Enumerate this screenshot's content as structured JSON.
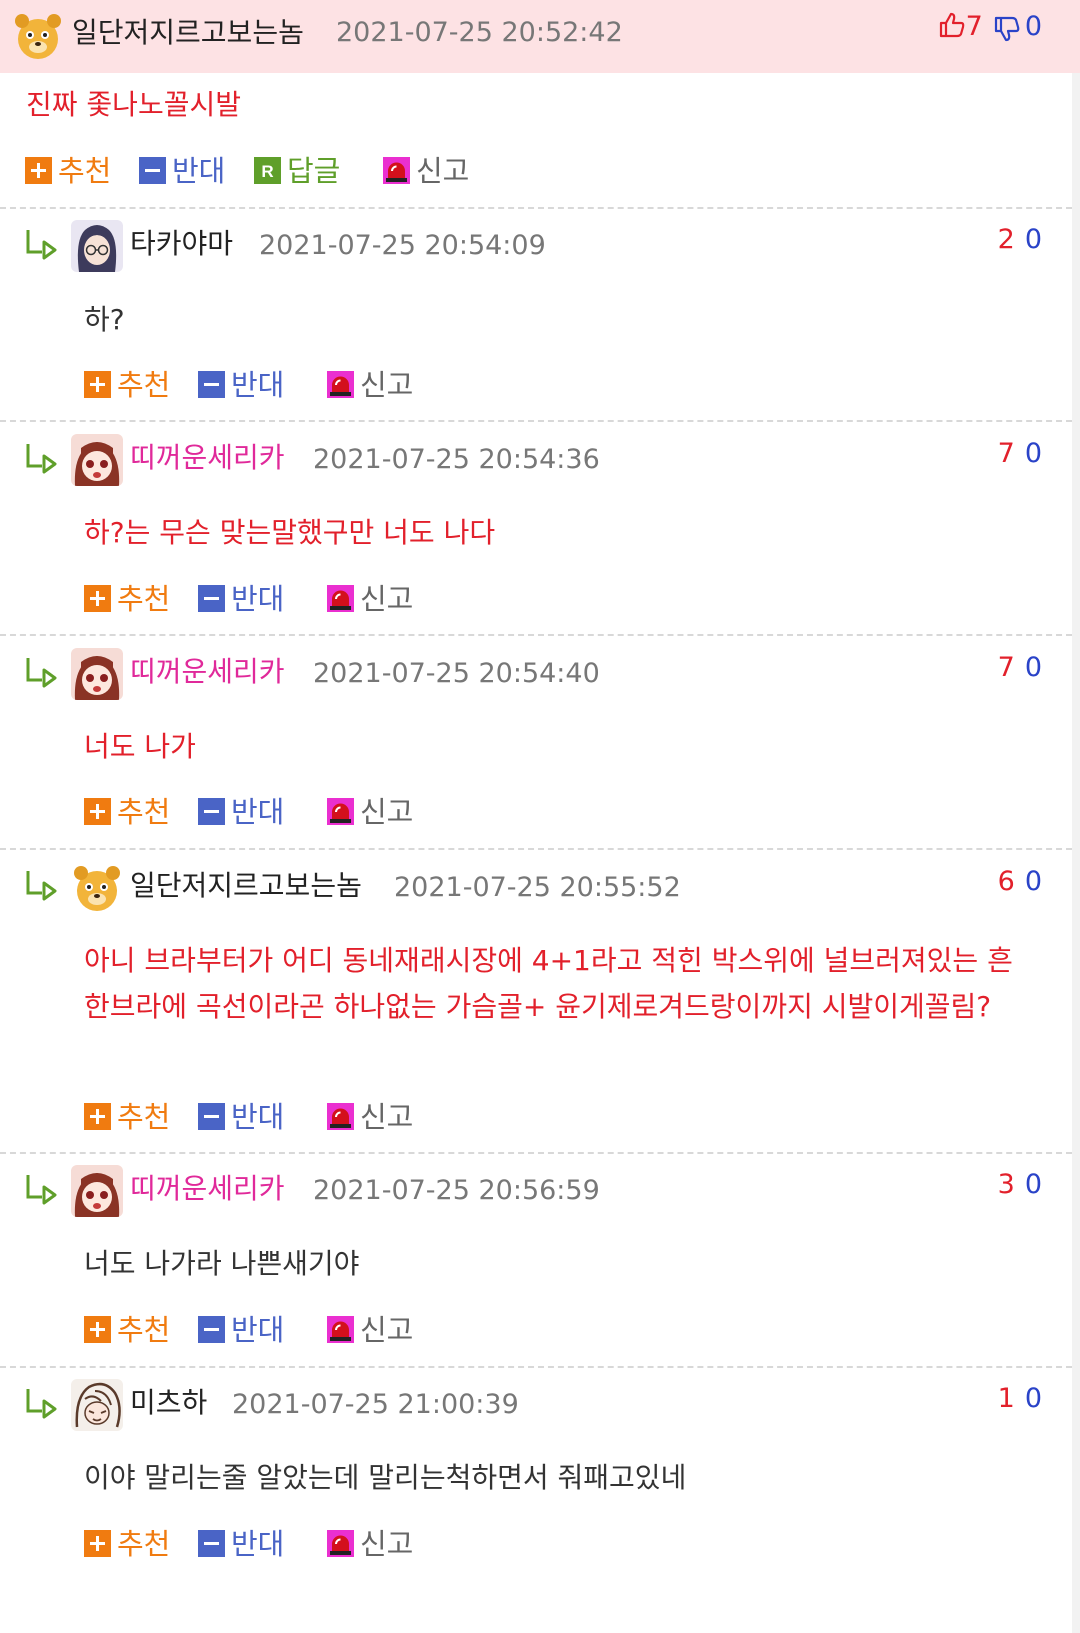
{
  "post": {
    "nick": "일단저지르고보는놈",
    "date": "2021-07-25 20:52:42",
    "up": "7",
    "down": "0",
    "text": "진짜 좇나노꼴시발"
  },
  "actions": {
    "recommend": "추천",
    "oppose": "반대",
    "reply": "답글",
    "report": "신고"
  },
  "replies": [
    {
      "nick": "타카야마",
      "date": "2021-07-25 20:54:09",
      "up": "2",
      "down": "0",
      "text": "하?"
    },
    {
      "nick": "띠꺼운세리카",
      "date": "2021-07-25 20:54:36",
      "up": "7",
      "down": "0",
      "text": "하?는 무슨 맞는말했구만 너도 나다"
    },
    {
      "nick": "띠꺼운세리카",
      "date": "2021-07-25 20:54:40",
      "up": "7",
      "down": "0",
      "text": "너도 나가"
    },
    {
      "nick": "일단저지르고보는놈",
      "date": "2021-07-25 20:55:52",
      "up": "6",
      "down": "0",
      "text": "아니 브라부터가 어디 동네재래시장에 4+1라고 적힌 박스위에 널브러져있는 흔한브라에 곡선이라곤 하나없는 가슴골+ 윤기제로겨드랑이까지 시발이게꼴림?"
    },
    {
      "nick": "띠꺼운세리카",
      "date": "2021-07-25 20:56:59",
      "up": "3",
      "down": "0",
      "text": "너도 나가라 나쁜새기야"
    },
    {
      "nick": "미츠하",
      "date": "2021-07-25 21:00:39",
      "up": "1",
      "down": "0",
      "text": "이야 말리는줄 알았는데 말리는척하면서 줘패고있네"
    }
  ],
  "colors": {
    "header_bg": "#fde2e4",
    "red_text": "#e2202b",
    "down_blue": "#2a43c8",
    "recommend_orange": "#f07b10",
    "oppose_blue": "#4a64c6",
    "reply_green": "#5f9f2a",
    "nick_pink": "#e0299a"
  }
}
